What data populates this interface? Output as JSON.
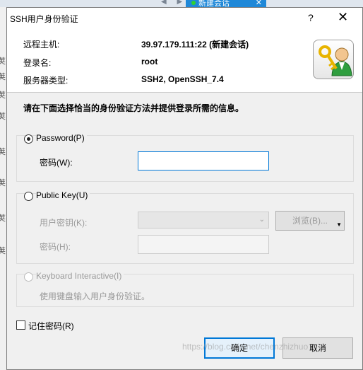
{
  "background": {
    "nav_arrows": "◀ ▶",
    "session_tab_label": "新建会话",
    "tab_close": "✕",
    "left_edge_chars": [
      "荚",
      "荚",
      "荚",
      "荚",
      "荚",
      "荚",
      "荚",
      "荚"
    ]
  },
  "dialog": {
    "title": "SSH用户身份验证",
    "help_label": "?",
    "close_label": "✕"
  },
  "info": {
    "remote_host_label": "远程主机:",
    "remote_host_value": "39.97.179.111:22 (新建会话)",
    "login_label": "登录名:",
    "login_value": "root",
    "server_type_label": "服务器类型:",
    "server_type_value": "SSH2, OpenSSH_7.4"
  },
  "instruction": "请在下面选择恰当的身份验证方法并提供登录所需的信息。",
  "password_group": {
    "radio_label": "Password(P)",
    "password_label": "密码(W):",
    "password_value": ""
  },
  "publickey_group": {
    "radio_label": "Public Key(U)",
    "user_key_label": "用户密钥(K):",
    "browse_label": "浏览(B)...",
    "passphrase_label": "密码(H):"
  },
  "keyboard_group": {
    "radio_label": "Keyboard Interactive(I)",
    "description": "使用键盘输入用户身份验证。"
  },
  "remember_password_label": "记住密码(R)",
  "ok_label": "确定",
  "cancel_label": "取消",
  "watermark": "https://blog.csdn.net/chenzhizhuo"
}
